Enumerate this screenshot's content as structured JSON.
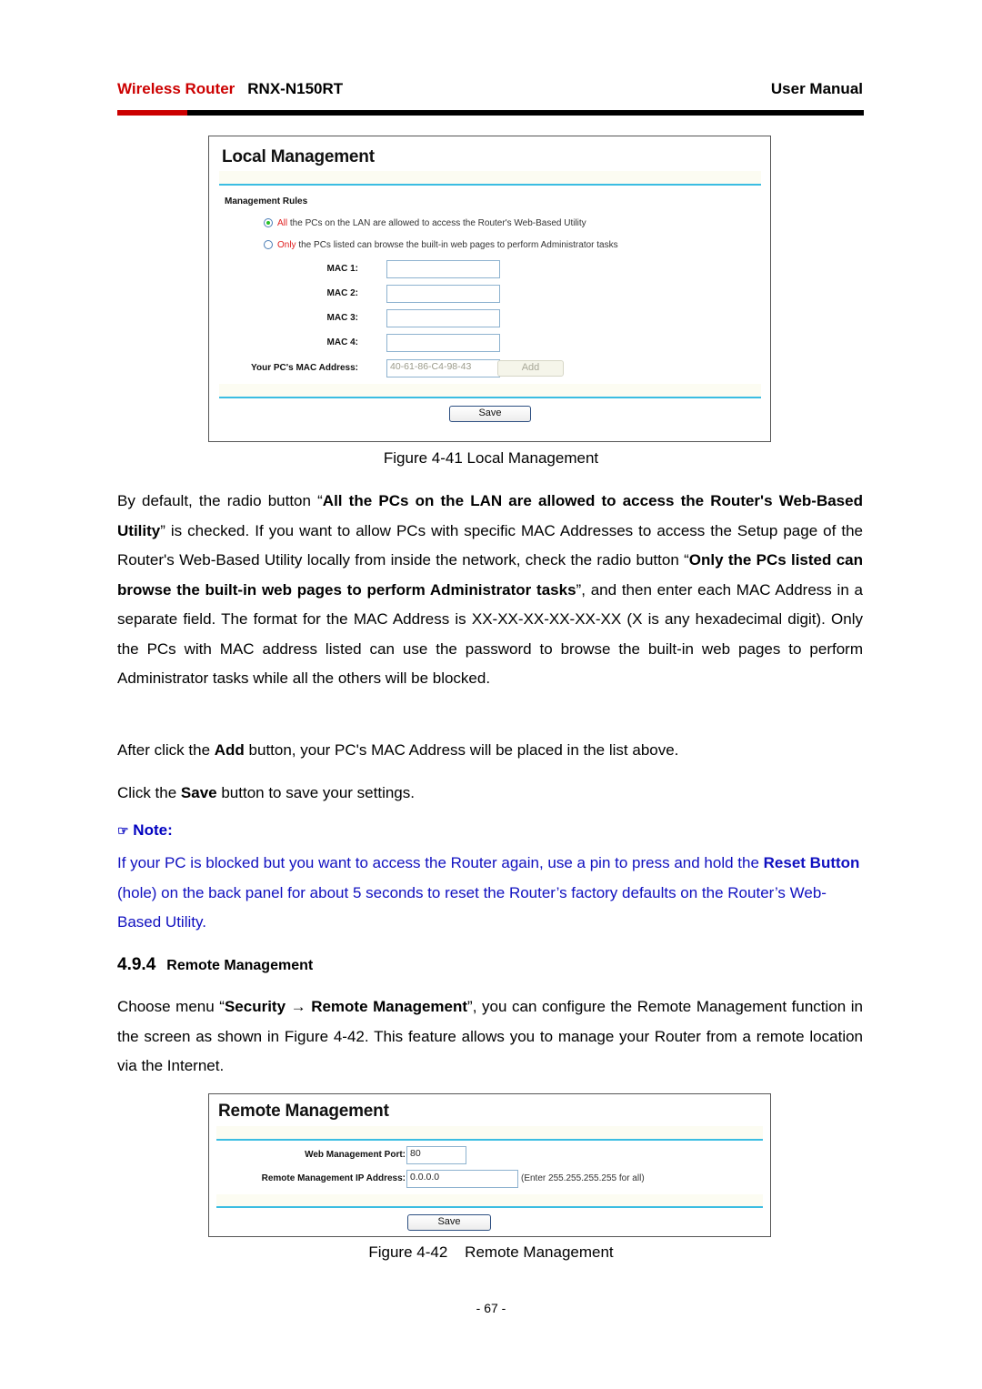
{
  "header": {
    "brand": "Wireless Router",
    "model": "RNX-N150RT",
    "doc_type": "User Manual",
    "colors": {
      "brand": "#cc0000",
      "rule": "#000000"
    }
  },
  "figure_local": {
    "title": "Local Management",
    "section_label": "Management Rules",
    "rule_options": [
      {
        "highlight": "All",
        "text": " the PCs on the LAN are allowed to access the Router's Web-Based Utility",
        "selected": true
      },
      {
        "highlight": "Only",
        "text": " the PCs listed can browse the built-in web pages to perform Administrator tasks",
        "selected": false
      }
    ],
    "mac_fields": [
      {
        "label": "MAC 1:",
        "value": ""
      },
      {
        "label": "MAC 2:",
        "value": ""
      },
      {
        "label": "MAC 3:",
        "value": ""
      },
      {
        "label": "MAC 4:",
        "value": ""
      }
    ],
    "pc_mac": {
      "label": "Your PC's MAC Address:",
      "value": "40-61-86-C4-98-43"
    },
    "add_label": "Add",
    "save_label": "Save",
    "caption": "Figure 4-41 Local Management"
  },
  "body": {
    "p1": [
      {
        "t": "By default, the radio button “",
        "b": false
      },
      {
        "t": "All the PCs on the LAN are allowed to access the Router's Web-Based Utility",
        "b": true
      },
      {
        "t": "” is checked. If you want to allow PCs with specific MAC Addresses to access the Setup page of the Router's Web-Based Utility locally from inside the network, check the radio button “",
        "b": false
      },
      {
        "t": "Only the PCs listed can browse the built-in web pages to perform Administrator tasks",
        "b": true
      },
      {
        "t": "”, and then enter each MAC Address in a separate field. The format for the MAC Address is XX-XX-XX-XX-XX-XX (X is any hexadecimal digit). Only the PCs with MAC address listed can use the password to browse the built-in web pages to perform Administrator tasks while all the others will be blocked.",
        "b": false
      }
    ],
    "p2": [
      {
        "t": "After click the ",
        "b": false
      },
      {
        "t": "Add",
        "b": true
      },
      {
        "t": " button, your PC's MAC Address will be placed in the list above.",
        "b": false
      }
    ],
    "p3": [
      {
        "t": "Click the ",
        "b": false
      },
      {
        "t": "Save",
        "b": true
      },
      {
        "t": " button to save your settings.",
        "b": false
      }
    ],
    "note_icon": "pointing-hand-icon",
    "note_label": "Note:",
    "note": [
      {
        "t": "If your PC is blocked but you want to access the Router again, use a pin to press and hold the ",
        "b": false
      },
      {
        "t": "Reset Button",
        "b": true
      },
      {
        "t": " (hole) on the back panel for about 5 seconds to reset the Router’s factory defaults on the Router’s Web-Based Utility.",
        "b": false
      }
    ],
    "note_color": "#1010c0",
    "section_number": "4.9.4",
    "section_title": "Remote Management",
    "p4": [
      {
        "t": "Choose menu “",
        "b": false
      },
      {
        "t": "Security → Remote Management",
        "b": true
      },
      {
        "t": "”, you can configure the Remote Management function in the screen as shown in Figure 4-42. This feature allows you to manage your Router from a remote location via the Internet.",
        "b": false
      }
    ]
  },
  "figure_remote": {
    "title": "Remote Management",
    "port": {
      "label": "Web Management Port:",
      "value": "80"
    },
    "ip": {
      "label": "Remote Management IP Address:",
      "value": "0.0.0.0",
      "hint": "(Enter 255.255.255.255 for all)"
    },
    "save_label": "Save",
    "caption": "Figure 4-42    Remote Management"
  },
  "footer": {
    "page_number": "- 67 -"
  }
}
